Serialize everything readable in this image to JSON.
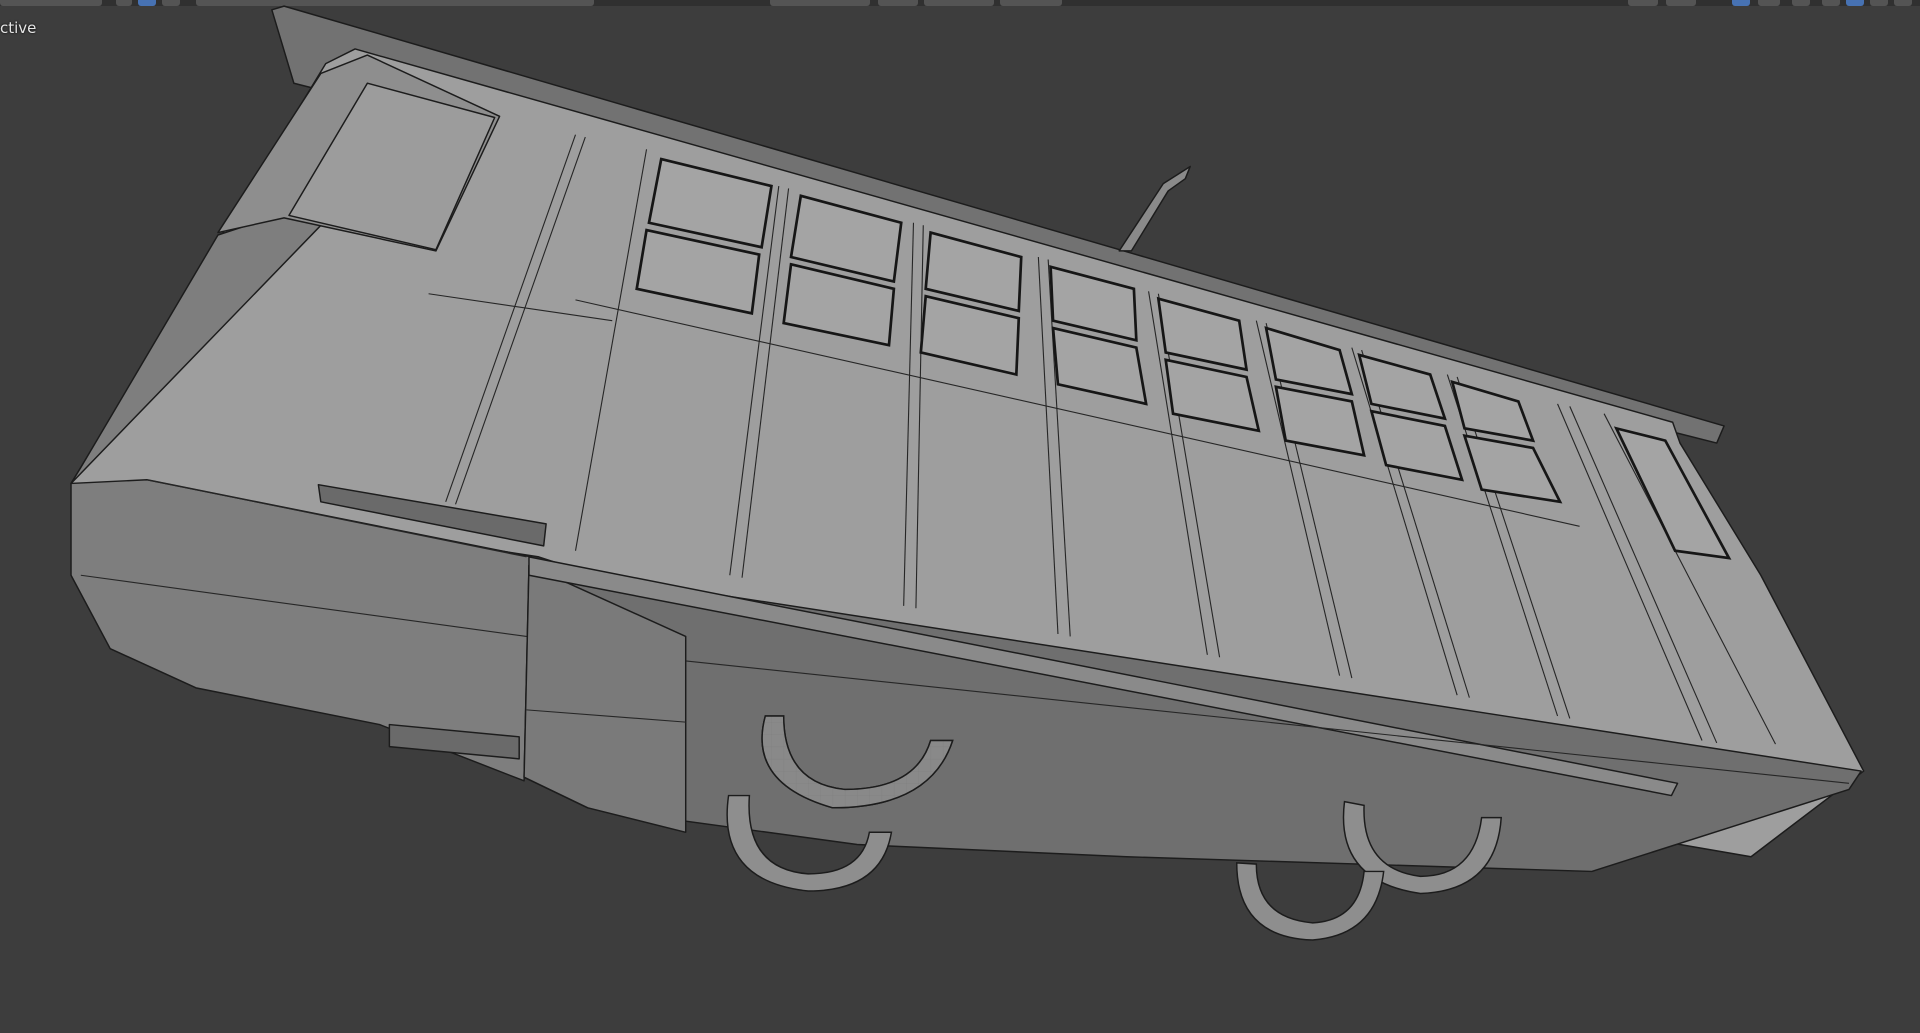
{
  "viewport": {
    "view_label": "ctive",
    "shading_mode": "solid-wireframe",
    "background_color": "#3d3d3d",
    "mesh_color": "#9c9c9c",
    "wire_color": "#1c1c1c"
  },
  "header": {
    "select_mode_icons": [
      "vertex-select-icon",
      "edge-select-icon",
      "face-select-icon"
    ],
    "active_select_mode": "edge-select-icon",
    "right_icons": [
      "overlay-icon",
      "xray-icon",
      "wireframe-shading-icon",
      "solid-shading-icon",
      "material-shading-icon",
      "rendered-shading-icon"
    ]
  }
}
